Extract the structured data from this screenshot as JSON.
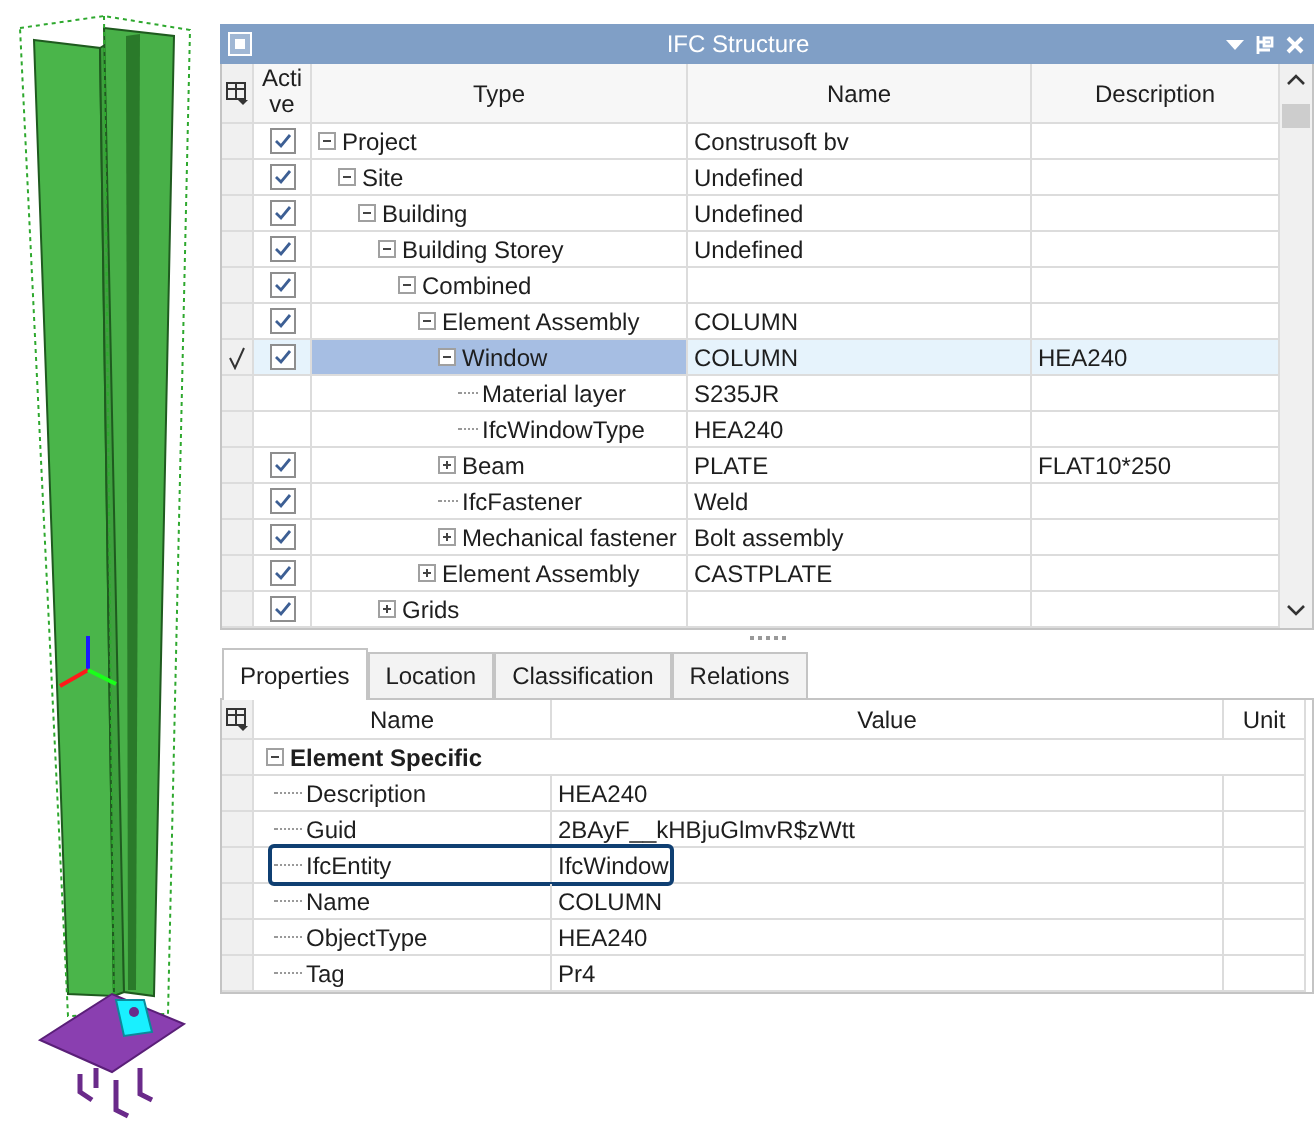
{
  "panel": {
    "title": "IFC Structure"
  },
  "tree": {
    "columns": [
      "Active",
      "Type",
      "Name",
      "Description"
    ],
    "rows": [
      {
        "type": "Project",
        "name": "Construsoft bv",
        "active": true,
        "selected": false,
        "expanded": true,
        "children": [
          {
            "type": "Site",
            "name": "Undefined",
            "active": true,
            "selected": false,
            "expanded": true,
            "children": [
              {
                "type": "Building",
                "name": "Undefined",
                "active": true,
                "selected": false,
                "expanded": true,
                "children": [
                  {
                    "type": "Building Storey",
                    "name": "Undefined",
                    "active": true,
                    "selected": false,
                    "expanded": true,
                    "children": [
                      {
                        "type": "Combined",
                        "active": true,
                        "selected": false,
                        "expanded": true,
                        "children": [
                          {
                            "type": "Element Assembly",
                            "name": "COLUMN",
                            "active": true,
                            "selected": false,
                            "expanded": true,
                            "children": [
                              {
                                "type": "Window",
                                "name": "COLUMN",
                                "description": "HEA240",
                                "active": true,
                                "selected": true,
                                "expanded": true,
                                "children": [
                                  {
                                    "type": "Material layer",
                                    "name": "S235JR",
                                    "selected": false
                                  },
                                  {
                                    "type": "IfcWindowType",
                                    "name": "HEA240",
                                    "selected": false
                                  }
                                ]
                              },
                              {
                                "type": "Beam",
                                "name": "PLATE",
                                "description": "FLAT10*250",
                                "active": true,
                                "selected": false,
                                "expanded": false
                              },
                              {
                                "type": "IfcFastener",
                                "name": "Weld",
                                "active": true,
                                "selected": false
                              },
                              {
                                "type": "Mechanical fastener",
                                "name": "Bolt assembly",
                                "active": true,
                                "selected": false,
                                "expanded": false
                              }
                            ]
                          },
                          {
                            "type": "Element Assembly",
                            "name": "CASTPLATE",
                            "active": true,
                            "selected": false,
                            "expanded": false
                          }
                        ]
                      }
                    ]
                  },
                  {
                    "type": "Grids",
                    "active": true,
                    "selected": false,
                    "expanded": false
                  }
                ]
              }
            ]
          }
        ]
      }
    ]
  },
  "tabs": [
    {
      "label": "Properties",
      "selected": true
    },
    {
      "label": "Location",
      "selected": false
    },
    {
      "label": "Classification",
      "selected": false
    },
    {
      "label": "Relations",
      "selected": false
    }
  ],
  "properties": {
    "columns": [
      "Name",
      "Value",
      "Unit"
    ],
    "group": {
      "label": "Element Specific",
      "expanded": true
    },
    "rows": [
      {
        "name": "Description",
        "value": "HEA240",
        "highlighted": false
      },
      {
        "name": "Guid",
        "value": "2BAyF__kHBjuGlmvR$zWtt",
        "highlighted": false
      },
      {
        "name": "IfcEntity",
        "value": "IfcWindow",
        "highlighted": true
      },
      {
        "name": "Name",
        "value": "COLUMN",
        "highlighted": false
      },
      {
        "name": "ObjectType",
        "value": "HEA240",
        "highlighted": false
      },
      {
        "name": "Tag",
        "value": "Pr4",
        "highlighted": false
      }
    ]
  }
}
